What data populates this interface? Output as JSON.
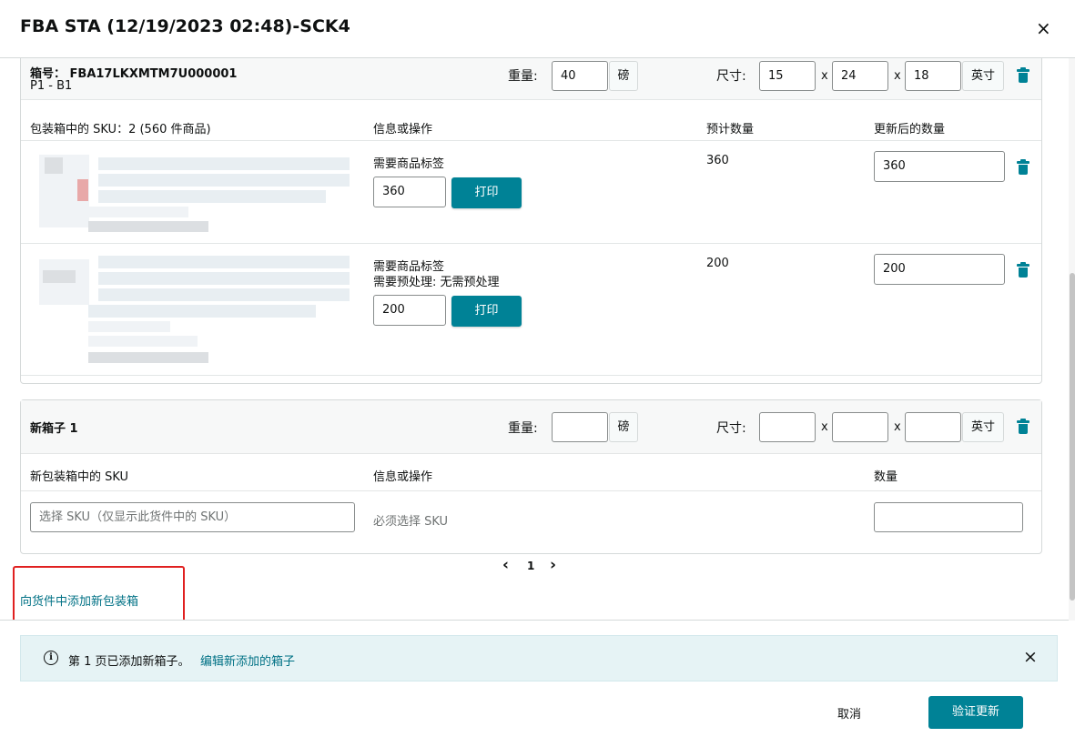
{
  "modal": {
    "title": "FBA STA (12/19/2023 02:48)-SCK4",
    "close_glyph": "×"
  },
  "box1": {
    "box_id_label": "箱号： FBA17LKXMTM7U000001",
    "box_sub": "P1 - B1",
    "weight_label": "重量:",
    "weight_value": "40",
    "weight_unit": "磅",
    "dim_label": "尺寸:",
    "dim_l": "15",
    "dim_w": "24",
    "dim_h": "18",
    "dim_sep": "x",
    "dim_unit": "英寸",
    "col_sku": "包装箱中的 SKU：2 (560 件商品)",
    "col_info": "信息或操作",
    "col_expected": "预计数量",
    "col_updated": "更新后的数量",
    "rows": [
      {
        "info_line1": "需要商品标签",
        "info_line2": "",
        "label_qty": "360",
        "print_label": "打印",
        "expected": "360",
        "updated": "360"
      },
      {
        "info_line1": "需要商品标签",
        "info_line2": "需要预处理: 无需预处理",
        "label_qty": "200",
        "print_label": "打印",
        "expected": "200",
        "updated": "200"
      }
    ]
  },
  "box_new": {
    "title": "新箱子 1",
    "weight_label": "重量:",
    "weight_value": "",
    "weight_unit": "磅",
    "dim_label": "尺寸:",
    "dim_sep": "x",
    "dim_unit": "英寸",
    "col_sku": "新包装箱中的 SKU",
    "col_info": "信息或操作",
    "col_qty": "数量",
    "sku_placeholder": "选择 SKU（仅显示此货件中的 SKU）",
    "sku_required": "必须选择 SKU",
    "qty_value": ""
  },
  "pagination": {
    "prev": "‹",
    "current": "1",
    "next": "›"
  },
  "add_box_link": "向货件中添加新包装箱",
  "alert": {
    "icon": "info-icon",
    "message": "第 1 页已添加新箱子。",
    "link": "编辑新添加的箱子",
    "close_glyph": "×"
  },
  "footer": {
    "cancel": "取消",
    "submit": "验证更新"
  },
  "colors": {
    "accent": "#008296",
    "link": "#007185",
    "highlight_border": "#e02020",
    "alert_bg": "#e6f3f5"
  }
}
